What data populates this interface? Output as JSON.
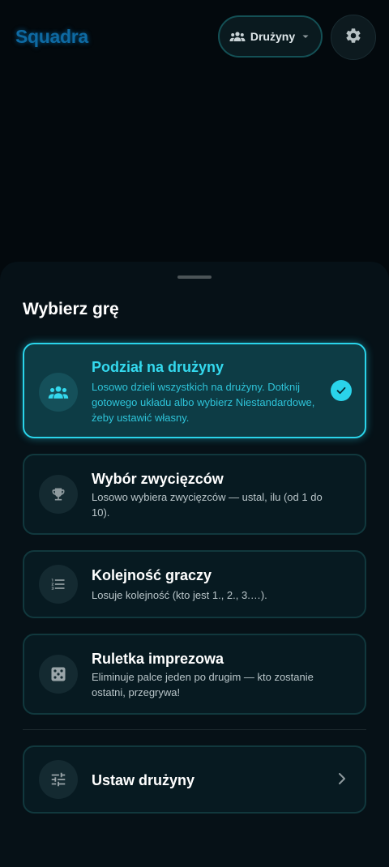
{
  "header": {
    "logo": "Squadra",
    "mode_label": "Drużyny"
  },
  "sheet": {
    "title": "Wybierz grę",
    "cards": [
      {
        "title": "Podział na drużyny",
        "description": "Losowo dzieli wszystkich na drużyny. Dotknij gotowego układu albo wybierz Niestandardowe, żeby ustawić własny.",
        "icon": "groups-icon",
        "selected": true
      },
      {
        "title": "Wybór zwycięzców",
        "description": "Losowo wybiera zwycięzców — ustal, ilu (od 1 do 10).",
        "icon": "trophy-icon",
        "selected": false
      },
      {
        "title": "Kolejność graczy",
        "description": "Losuje kolejność (kto jest 1., 2., 3.…).",
        "icon": "numbered-list-icon",
        "selected": false
      },
      {
        "title": "Ruletka imprezowa",
        "description": "Eliminuje palce jeden po drugim — kto zostanie ostatni, przegrywa!",
        "icon": "dice-icon",
        "selected": false
      }
    ],
    "setup": {
      "label": "Ustaw drużyny",
      "icon": "tune-icon"
    }
  },
  "colors": {
    "accent": "#2ad4ea",
    "logo": "#0e6aa3",
    "background": "#03090d",
    "sheet": "#061117"
  }
}
